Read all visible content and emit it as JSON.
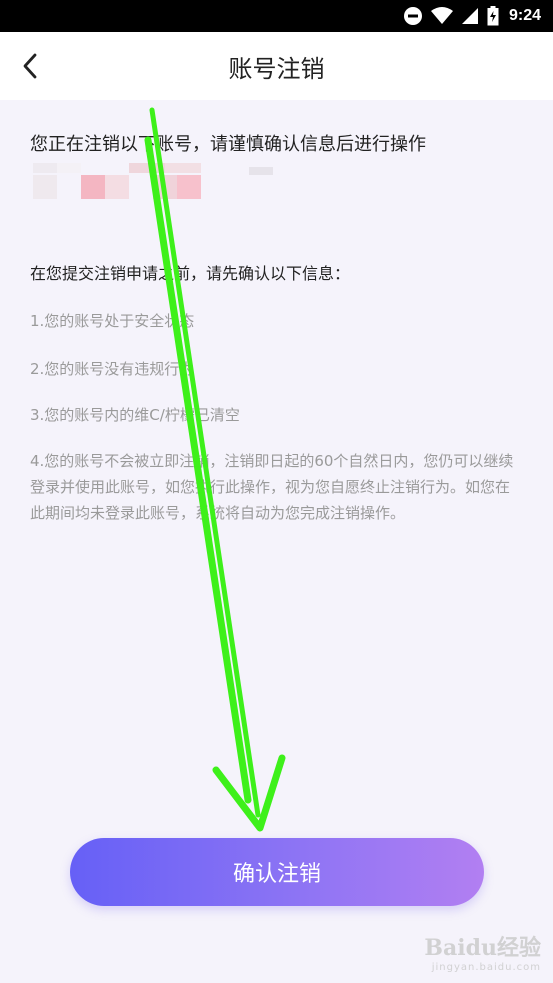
{
  "status_bar": {
    "time": "9:24",
    "icons": [
      "do-not-disturb-icon",
      "wifi-icon",
      "signal-icon",
      "battery-icon"
    ]
  },
  "nav": {
    "back_icon": "chevron-left-icon",
    "title": "账号注销"
  },
  "intro": "您正在注销以下账号，请谨慎确认信息后进行操作",
  "notice": {
    "heading": "在您提交注销申请之前，请先确认以下信息：",
    "items": [
      "1.您的账号处于安全状态",
      "2.您的账号没有违规行为",
      "3.您的账号内的维C/柠檬已清空",
      "4.您的账号不会被立即注销，注销即日起的60个自然日内，您仍可以继续登录并使用此账号，如您执行此操作，视为您自愿终止注销行为。如您在此期间均未登录此账号，系统将自动为您完成注销操作。"
    ]
  },
  "confirm_button": "确认注销",
  "watermark": {
    "logo": "Baidu经验",
    "domain": "jingyan.baidu.com"
  },
  "colors": {
    "annotation_arrow": "#3ef01a",
    "button_gradient_start": "#6660f6",
    "button_gradient_end": "#b27ff2"
  }
}
